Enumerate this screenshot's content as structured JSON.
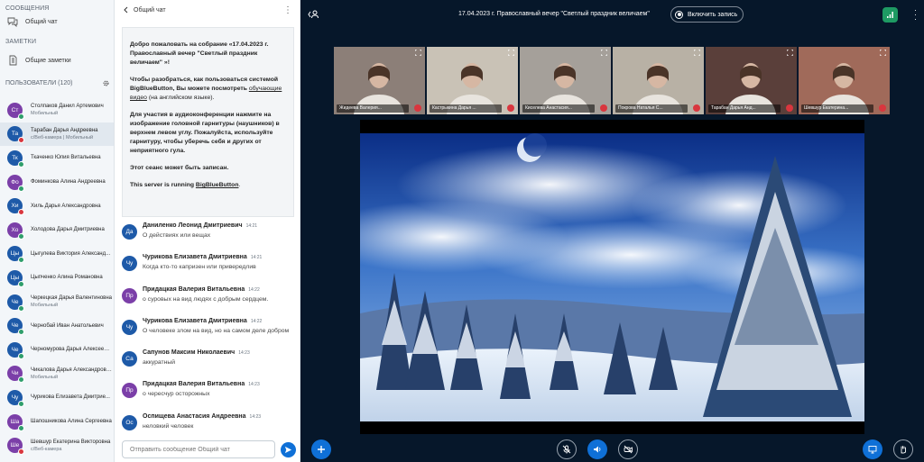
{
  "sidebar": {
    "messages_title": "СООБЩЕНИЯ",
    "public_chat": "Общий чат",
    "notes_title": "ЗАМЕТКИ",
    "shared_notes": "Общие заметки",
    "users_title": "ПОЛЬЗОВАТЕЛИ (120)",
    "users": [
      {
        "initials": "Ст",
        "name": "Столпаков Данил Артемович",
        "sub": "Мобильный",
        "color": "#7b3fa8",
        "status": "#2f9e6b"
      },
      {
        "initials": "Та",
        "name": "Тарабан Дарья Андреевна",
        "sub": "с/Веб-камера | Мобильный",
        "color": "#1e5aa8",
        "status": "#d9363e"
      },
      {
        "initials": "Тк",
        "name": "Ткаченко Юлия Витальевна",
        "sub": "",
        "color": "#1e5aa8",
        "status": "#2f9e6b"
      },
      {
        "initials": "Фо",
        "name": "Фоминкова Алина Андреевна",
        "sub": "",
        "color": "#7b3fa8",
        "status": "#2f9e6b"
      },
      {
        "initials": "Хи",
        "name": "Хиль Дарья Александровна",
        "sub": "",
        "color": "#1e5aa8",
        "status": "#d9363e"
      },
      {
        "initials": "Хо",
        "name": "Холодова Дарья Дмитриевна",
        "sub": "",
        "color": "#7b3fa8",
        "status": "#2f9e6b"
      },
      {
        "initials": "Цы",
        "name": "Цыгулева Виктория Александ...",
        "sub": "",
        "color": "#1e5aa8",
        "status": "#2f9e6b"
      },
      {
        "initials": "Цы",
        "name": "Цыпченко Алина Романовна",
        "sub": "",
        "color": "#1e5aa8",
        "status": "#2f9e6b"
      },
      {
        "initials": "Че",
        "name": "Черкецкая Дарья Валентиновна",
        "sub": "Мобильный",
        "color": "#1e5aa8",
        "status": "#2f9e6b"
      },
      {
        "initials": "Че",
        "name": "Чернобай Иван Анатольевич",
        "sub": "",
        "color": "#1e5aa8",
        "status": "#2f9e6b"
      },
      {
        "initials": "Че",
        "name": "Черномурова Дарья Алексеевна",
        "sub": "",
        "color": "#1e5aa8",
        "status": "#2f9e6b"
      },
      {
        "initials": "Чи",
        "name": "Чикалова Дарья Александровна",
        "sub": "Мобильный",
        "color": "#7b3fa8",
        "status": "#2f9e6b"
      },
      {
        "initials": "Чу",
        "name": "Чурикова Елизавета Дмитрие...",
        "sub": "",
        "color": "#1e5aa8",
        "status": "#2f9e6b"
      },
      {
        "initials": "Ша",
        "name": "Шапошникова Алина Сергеевна",
        "sub": "",
        "color": "#7b3fa8",
        "status": "#2f9e6b"
      },
      {
        "initials": "Ше",
        "name": "Шевшур Екатерина Викторовна",
        "sub": "с/Веб-камера",
        "color": "#7b3fa8",
        "status": "#d9363e"
      }
    ]
  },
  "chat": {
    "title": "Общий чат",
    "welcome": {
      "p1a": "Добро пожаловать на собрание «17.04.2023 г. Православный вечер \"Светлый праздник величаем\" »!",
      "p2a": "Чтобы разобраться, как пользоваться системой BigBlueButton, Вы можете посмотреть ",
      "p2link": "обучающие видео",
      "p2b": " (на английском языке).",
      "p3a": "Для участия в аудиоконференции нажмите на изображение головной гарнитуры (наушников) в верхнем левом углу. ",
      "p3b": "Пожалуйста, используйте гарнитуру, чтобы уберечь себя и других от неприятного гула.",
      "p4": "Этот сеанс может быть записан.",
      "p5a": "This server is running ",
      "p5link": "BigBlueButton",
      "p5b": "."
    },
    "messages": [
      {
        "initials": "Да",
        "name": "Даниленко Леонид Дмитриевич",
        "time": "14:21",
        "text": "О действиях или вещах",
        "color": "#1e5aa8"
      },
      {
        "initials": "Чу",
        "name": "Чурикова Елизавета Дмитриевна",
        "time": "14:21",
        "text": "Когда кто-то капризен или привередлив",
        "color": "#1e5aa8"
      },
      {
        "initials": "Пр",
        "name": "Придацкая Валерия Витальевна",
        "time": "14:22",
        "text": "о суровых на вид людях с добрым сердцем.",
        "color": "#7b3fa8"
      },
      {
        "initials": "Чу",
        "name": "Чурикова Елизавета Дмитриевна",
        "time": "14:22",
        "text": "О человеке злом на вид, но на самом деле добром",
        "color": "#1e5aa8"
      },
      {
        "initials": "Са",
        "name": "Сапунов Максим Николаевич",
        "time": "14:23",
        "text": "аккуратный",
        "color": "#1e5aa8"
      },
      {
        "initials": "Пр",
        "name": "Придацкая Валерия Витальевна",
        "time": "14:23",
        "text": "о чересчур осторожных",
        "color": "#7b3fa8"
      },
      {
        "initials": "Ос",
        "name": "Оспищева Анастасия Андреевна",
        "time": "14:23",
        "text": "неловкий человек",
        "color": "#1e5aa8"
      }
    ],
    "input_placeholder": "Отправить сообщение Общий чат"
  },
  "main": {
    "meeting_title": "17.04.2023 г. Православный вечер \"Светлый праздник величаем\"",
    "record_label": "Включить запись",
    "cameras": [
      {
        "name": "Жидеева Валерия..."
      },
      {
        "name": "Кастрыкина Дарья ..."
      },
      {
        "name": "Киселева Анастасия..."
      },
      {
        "name": "Покрова Наталья С..."
      },
      {
        "name": "Тарабан Дарья Анд..."
      },
      {
        "name": "Шевшур Екатерина..."
      }
    ]
  },
  "colors": {
    "accent": "#0f70d7",
    "main_bg": "#06172a",
    "connection": "#1e9a63",
    "muted_mic": "#d9363e"
  }
}
